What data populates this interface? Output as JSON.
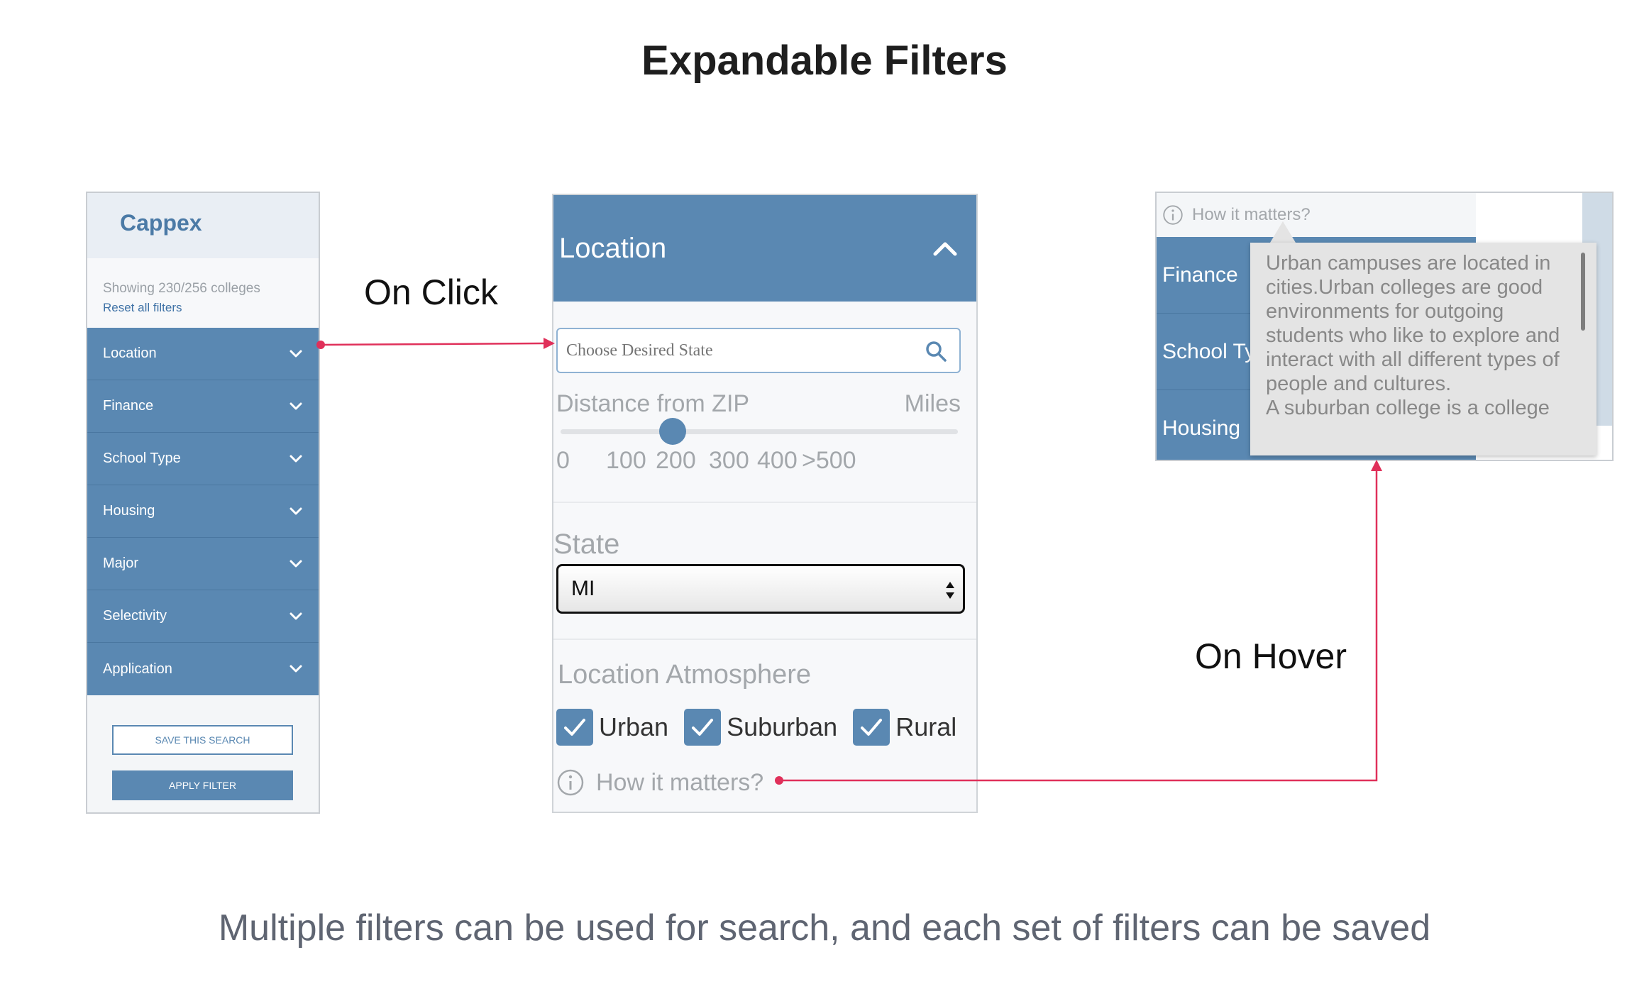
{
  "title": "Expandable Filters",
  "caption": "Multiple filters can be used for search, and each set of filters can be saved",
  "labels": {
    "on_click": "On Click",
    "on_hover": "On Hover"
  },
  "colors": {
    "brand_blue": "#5a88b2",
    "connector": "#e0305a",
    "muted_text": "#a3a7ab"
  },
  "sidebar": {
    "brand": "Cappex",
    "count_text": "Showing 230/256 colleges",
    "reset_link": "Reset all filters",
    "items": [
      {
        "label": "Location"
      },
      {
        "label": "Finance"
      },
      {
        "label": "School Type"
      },
      {
        "label": "Housing"
      },
      {
        "label": "Major"
      },
      {
        "label": "Selectivity"
      },
      {
        "label": "Application"
      }
    ],
    "save_button": "SAVE THIS SEARCH",
    "apply_button": "APPLY FILTER"
  },
  "location_panel": {
    "header": "Location",
    "search_placeholder": "Choose Desired State",
    "distance_label": "Distance from ZIP",
    "units_label": "Miles",
    "slider_ticks": [
      "0",
      "100",
      "200",
      "300",
      "400",
      ">500"
    ],
    "slider_value": 200,
    "state_label": "State",
    "state_value": "MI",
    "atmosphere_label": "Location Atmosphere",
    "checkboxes": [
      {
        "label": "Urban",
        "checked": true
      },
      {
        "label": "Suburban",
        "checked": true
      },
      {
        "label": "Rural",
        "checked": true
      }
    ],
    "hint": "How it matters?"
  },
  "hover_panel": {
    "hint": "How it matters?",
    "items": [
      {
        "label": "Finance"
      },
      {
        "label": "School Ty"
      },
      {
        "label": "Housing"
      }
    ],
    "tooltip_lines": [
      "Urban campuses are located in",
      "cities.Urban colleges are good",
      "environments for outgoing",
      "students who like to explore and",
      "interact with all different types of",
      "people and cultures.",
      "A suburban college is a college"
    ]
  }
}
